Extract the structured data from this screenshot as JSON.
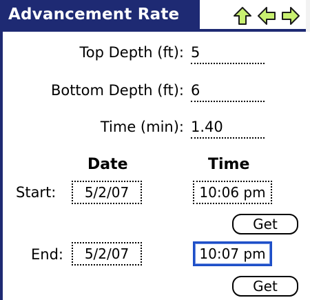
{
  "colors": {
    "title_bar": "#1e2a73",
    "icon_fill": "#c8f070",
    "focus_border": "#1e4fc8"
  },
  "title": "Advancement Rate",
  "nav": {
    "up_icon": "up-arrow-icon",
    "left_icon": "left-arrow-icon",
    "right_icon": "right-arrow-icon"
  },
  "fields": {
    "top_depth": {
      "label": "Top Depth (ft):",
      "value": "5"
    },
    "bottom_depth": {
      "label": "Bottom Depth (ft):",
      "value": "6"
    },
    "time": {
      "label": "Time (min):",
      "value": "1.40"
    }
  },
  "columns": {
    "date": "Date",
    "time": "Time"
  },
  "start": {
    "label": "Start:",
    "date": "5/2/07",
    "time": "10:06 pm",
    "button": "Get"
  },
  "end": {
    "label": "End:",
    "date": "5/2/07",
    "time": "10:07 pm",
    "button": "Get"
  }
}
